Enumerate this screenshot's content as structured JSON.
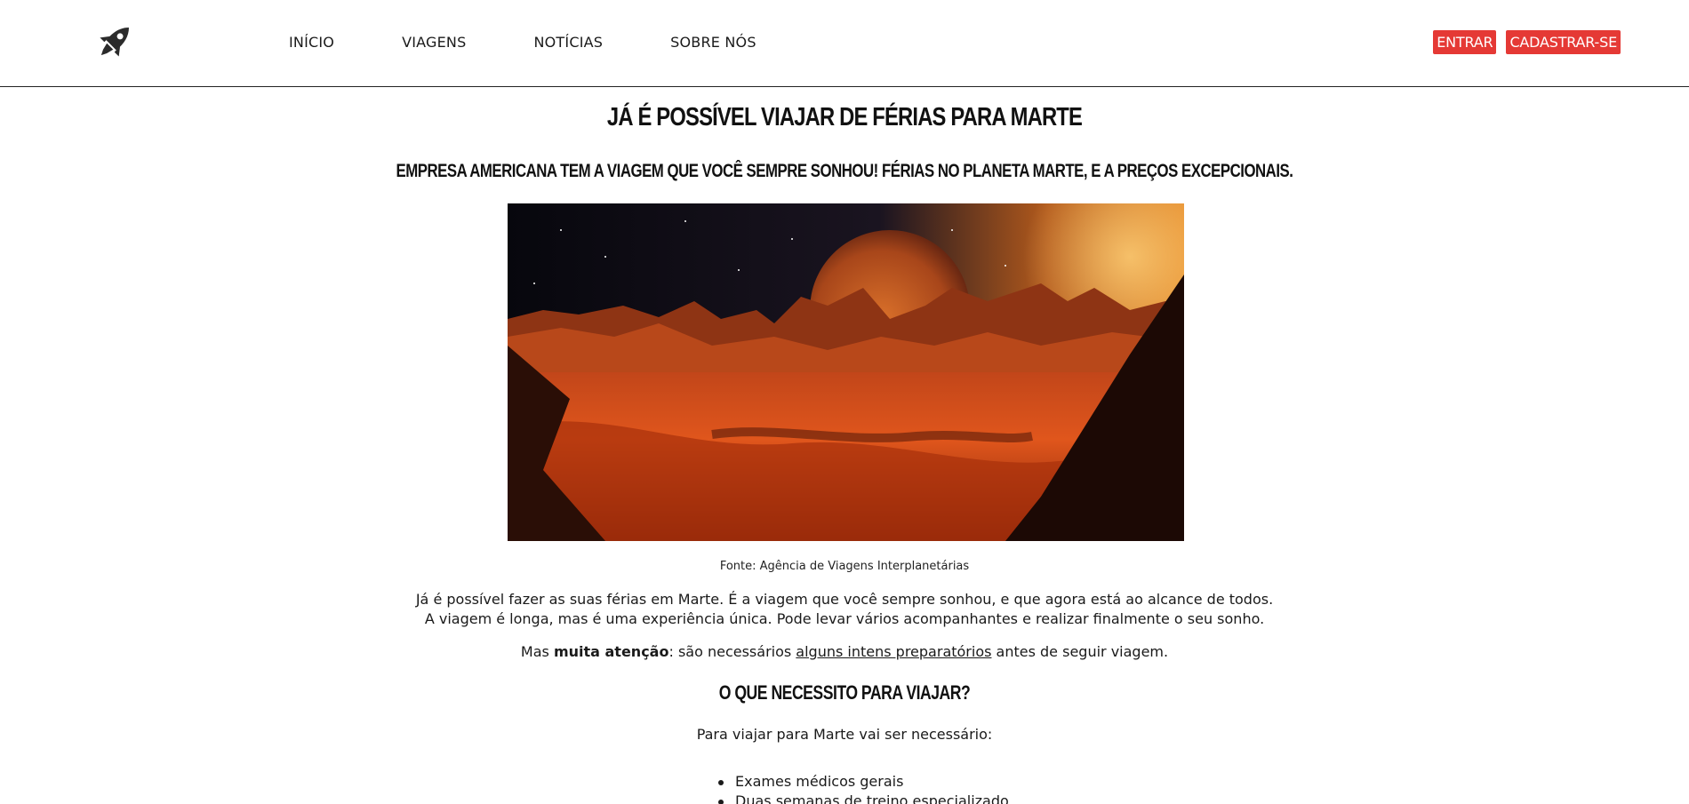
{
  "header": {
    "logo_icon": "rocket-icon",
    "nav": [
      {
        "label": "INÍCIO"
      },
      {
        "label": "VIAGENS"
      },
      {
        "label": "NOTÍCIAS"
      },
      {
        "label": "SOBRE NÓS"
      }
    ],
    "login_label": "ENTRAR",
    "signup_label": "CADASTRAR-SE",
    "button_color": "#e53935"
  },
  "article": {
    "title": "JÁ É POSSÍVEL VIAJAR DE FÉRIAS PARA MARTE",
    "subtitle": "EMPRESA AMERICANA TEM A VIAGEM QUE VOCÊ SEMPRE SONHOU! FÉRIAS NO PLANETA MARTE, E A PREÇOS EXCEPCIONAIS.",
    "caption": "Fonte: Agência de Viagens Interplanetárias",
    "paragraph1_line1": "Já é possível fazer as suas férias em Marte. É a viagem que você sempre sonhou, e que agora está ao alcance de todos.",
    "paragraph1_line2": "A viagem é longa, mas é uma experiência única. Pode levar vários acompanhantes e realizar finalmente o seu sonho.",
    "paragraph2": {
      "prefix": "Mas ",
      "bold": "muita atenção",
      "middle": ": são necessários ",
      "link": "alguns intens preparatórios",
      "suffix": " antes de seguir viagem."
    },
    "section_title": "O QUE NECESSITO PARA VIAJAR?",
    "section_intro": "Para viajar para Marte vai ser necessário:",
    "requirements": [
      "Exames médicos gerais",
      "Duas semanas de treino especializado"
    ]
  }
}
